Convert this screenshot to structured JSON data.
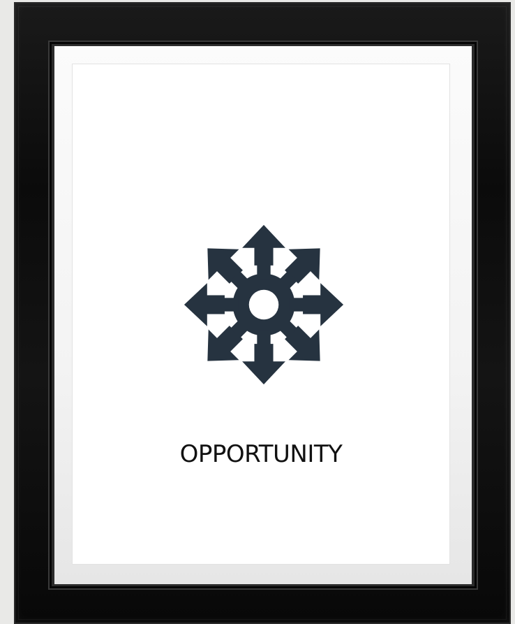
{
  "poster": {
    "caption": "OPPORTUNITY",
    "icon": "gear-with-outward-arrows-icon",
    "icon_color": "#263340",
    "frame_color": "#0b0b0b",
    "mat_color": "#f6f6f6"
  }
}
